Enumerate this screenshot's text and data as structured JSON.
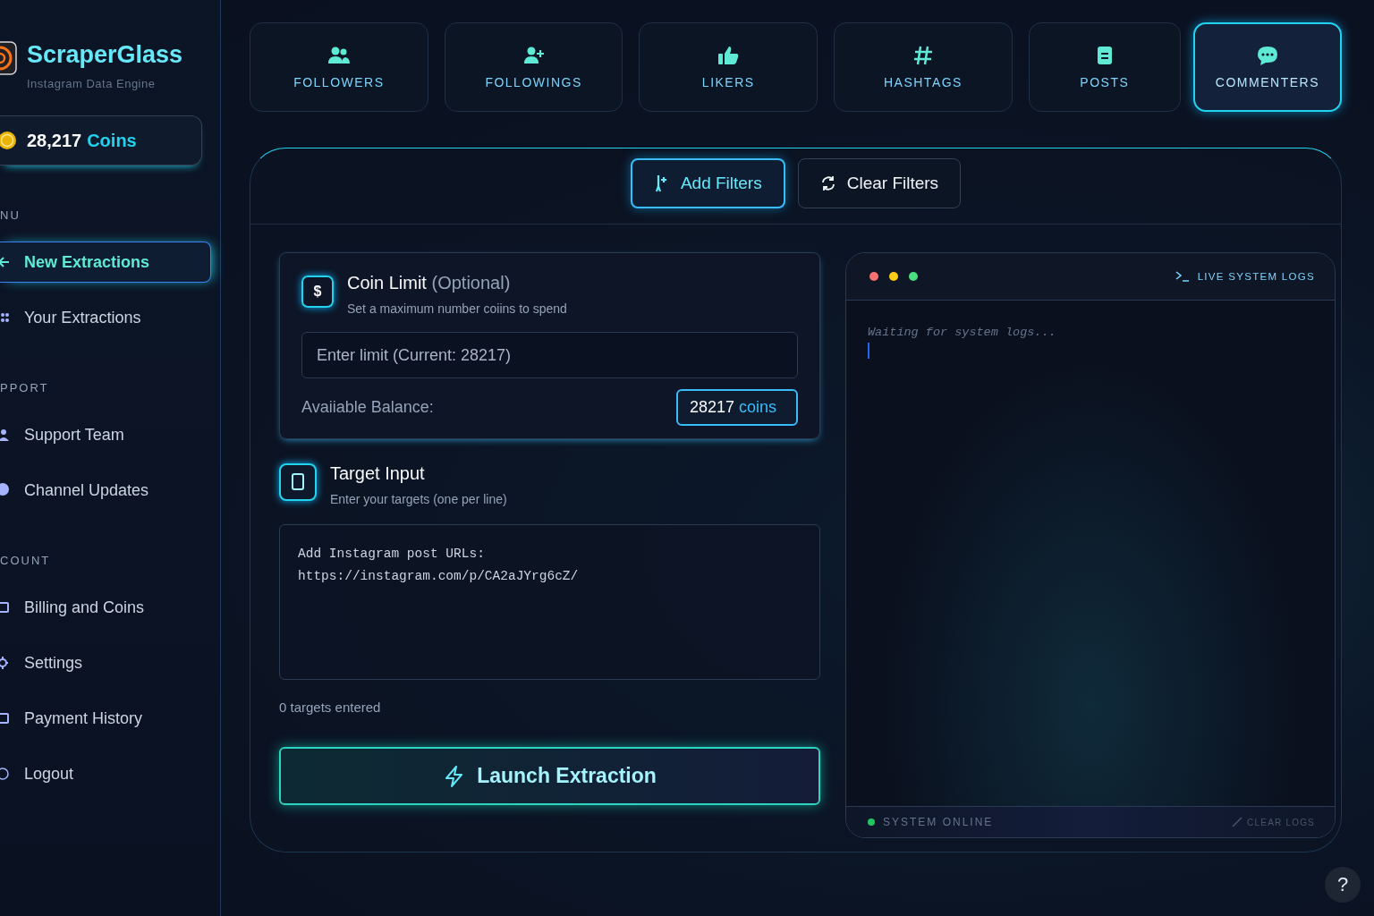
{
  "brand": {
    "name": "ScraperGlass",
    "subtitle": "Instagram Data Engine"
  },
  "coins": {
    "amount": "28,217",
    "unit": "Coins"
  },
  "sidebar": {
    "sections": [
      {
        "label": "NU",
        "items": [
          {
            "label": "New Extractions",
            "selected": true
          },
          {
            "label": "Your Extractions",
            "selected": false
          }
        ]
      },
      {
        "label": "PPORT",
        "items": [
          {
            "label": "Support Team",
            "selected": false
          },
          {
            "label": "Channel Updates",
            "selected": false
          }
        ]
      },
      {
        "label": "COUNT",
        "items": [
          {
            "label": "Billing and Coins",
            "selected": false
          },
          {
            "label": "Settings",
            "selected": false
          },
          {
            "label": "Payment History",
            "selected": false
          },
          {
            "label": "Logout",
            "selected": false
          }
        ]
      }
    ]
  },
  "tabs": [
    {
      "label": "FOLLOWERS",
      "selected": false
    },
    {
      "label": "FOLLOWINGS",
      "selected": false
    },
    {
      "label": "LIKERS",
      "selected": false
    },
    {
      "label": "HASHTAGS",
      "selected": false
    },
    {
      "label": "POSTS",
      "selected": false
    },
    {
      "label": "COMMENTERS",
      "selected": true
    }
  ],
  "filter_buttons": [
    {
      "label": "Add Filters",
      "kind": "primary"
    },
    {
      "label": "Clear Filters",
      "kind": "secondary"
    }
  ],
  "coin_limit": {
    "icon": "$",
    "title": "Coin Limit",
    "optional": "(Optional)",
    "subtitle": "Set a maximum number coiins to spend",
    "placeholder": "Enter limit (Current: 28217)",
    "balance_label": "Avaiiable Balance:",
    "balance_amount": "28217",
    "balance_unit": "coins"
  },
  "target_input": {
    "title": "Target Input",
    "subtitle": "Enter your targets (one per line)",
    "placeholder": "Add Instagram post URLs:\nhttps://instagram.com/p/CA2aJYrg6cZ/",
    "count": "0 targets entered"
  },
  "launch_button": "Launch Extraction",
  "logs": {
    "title": "LIVE SYSTEM LOGS",
    "dots": [
      {
        "color": "#f87171"
      },
      {
        "color": "#facc15"
      },
      {
        "color": "#4ade80"
      }
    ],
    "placeholder": "Waiting for system logs...",
    "status": "SYSTEM ONLINE",
    "clear": "CLEAR LOGS"
  },
  "help_button": "?"
}
